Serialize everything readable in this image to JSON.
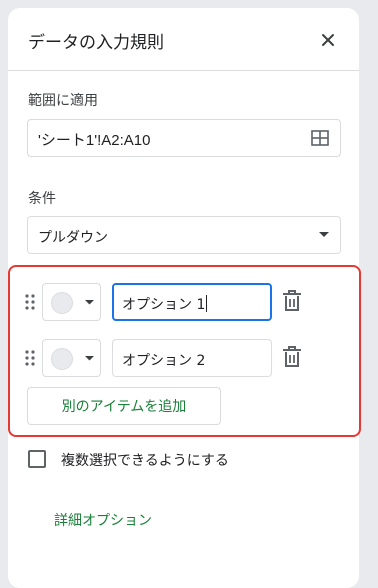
{
  "panel": {
    "title": "データの入力規則"
  },
  "range": {
    "label": "範囲に適用",
    "value": "'シート1'!A2:A10"
  },
  "criteria": {
    "label": "条件",
    "selected": "プルダウン"
  },
  "options": [
    {
      "value": "オプション 1",
      "active": true
    },
    {
      "value": "オプション 2",
      "active": false
    }
  ],
  "add_item_label": "別のアイテムを追加",
  "multi_select_label": "複数選択できるようにする",
  "advanced_label": "詳細オプション",
  "colors": {
    "highlight": "#e53935",
    "focus": "#1a73e8",
    "link": "#188038"
  }
}
